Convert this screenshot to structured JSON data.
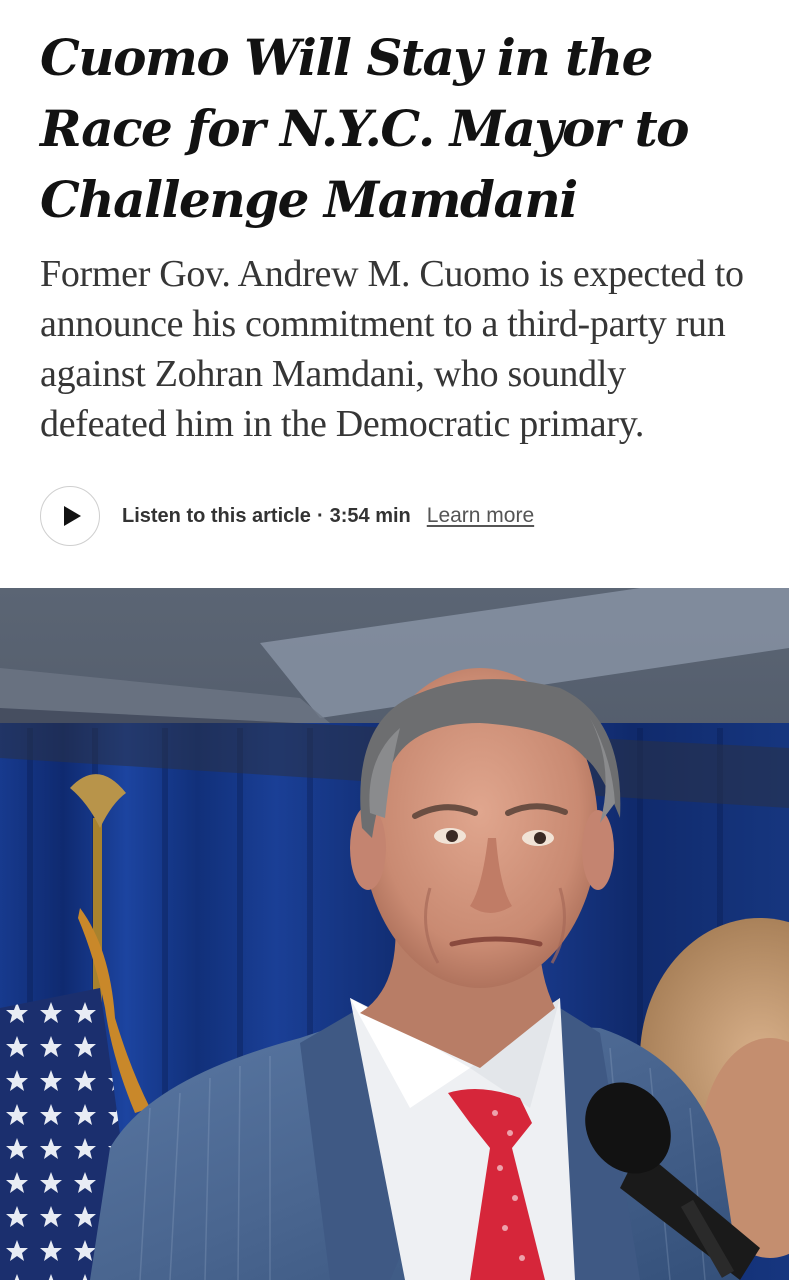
{
  "article": {
    "headline": "Cuomo Will Stay in the Race for N.Y.C. Mayor to Challenge Mamdani",
    "summary": "Former Gov. Andrew M. Cuomo is expected to announce his commitment to a third-party run against Zohran Mamdani, who soundly defeated him in the Democratic primary."
  },
  "audio": {
    "play_icon": "play-icon",
    "label": "Listen to this article",
    "separator": "·",
    "duration": "3:54 min",
    "learn_more": "Learn more"
  },
  "photo": {
    "subject": "photo"
  },
  "colors": {
    "text": "#121212",
    "summary_text": "#363636",
    "curtain_blue": "#1f3a8a",
    "tie_red": "#d6263a",
    "suit_blue": "#4d6890"
  }
}
